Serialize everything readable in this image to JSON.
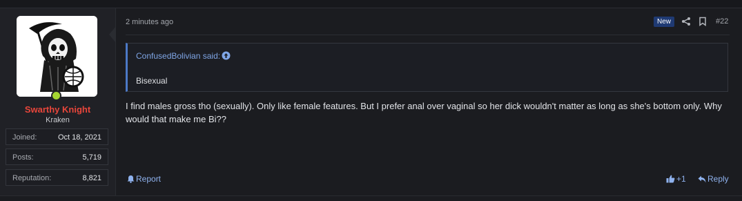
{
  "user": {
    "name": "Swarthy Knight",
    "title": "Kraken",
    "stats": [
      {
        "label": "Joined:",
        "value": "Oct 18, 2021"
      },
      {
        "label": "Posts:",
        "value": "5,719"
      },
      {
        "label": "Reputation:",
        "value": "8,821"
      }
    ],
    "name_color": "#e8463b",
    "online_color": "#a5d631",
    "avatar_icon": "grim-reaper-icon"
  },
  "post": {
    "timestamp": "2 minutes ago",
    "badge": "New",
    "number": "#22",
    "quote": {
      "author": "ConfusedBolivian said:",
      "text": "Bisexual"
    },
    "message": "I find males gross tho (sexually). Only like female features. But I prefer anal over vaginal so her dick wouldn't matter as long as she's bottom only. Why would that make me Bi??"
  },
  "actions": {
    "report_label": "Report",
    "like_label": "+1",
    "reply_label": "Reply"
  },
  "colors": {
    "link": "#8fb2ee",
    "quote_accent": "#4c79c6",
    "badge_bg": "#1f3a73"
  }
}
